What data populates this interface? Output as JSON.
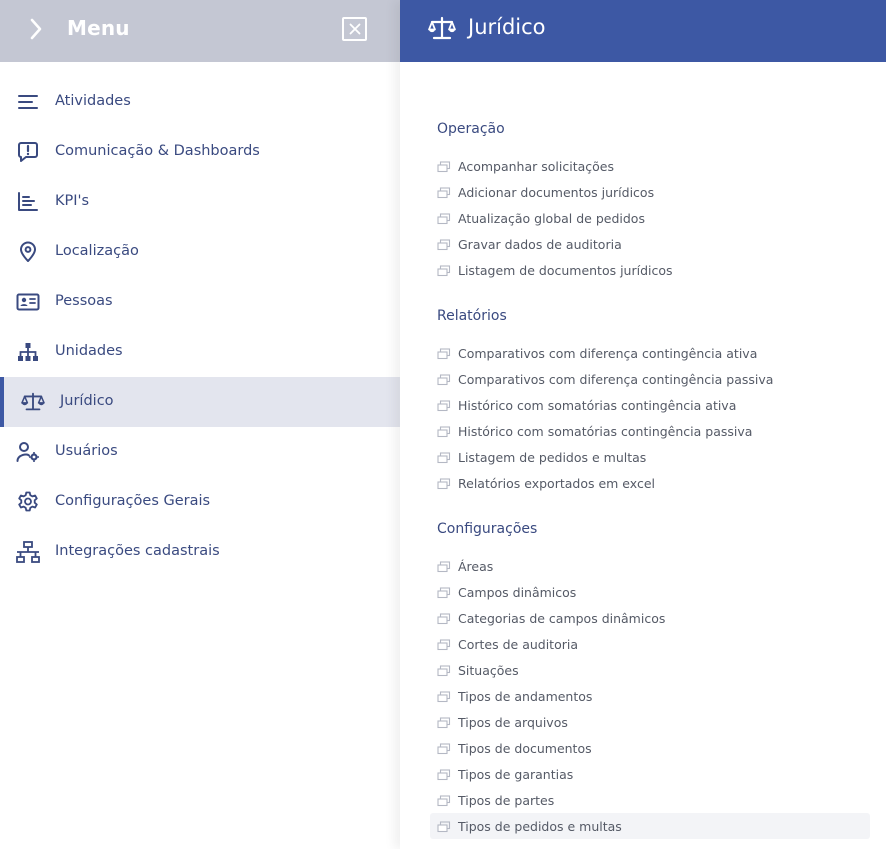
{
  "sidebar": {
    "title": "Menu",
    "chevron_icon": "chevron-right-icon",
    "close_icon": "close-box-icon",
    "items": [
      {
        "label": "Atividades",
        "icon": "list-icon"
      },
      {
        "label": "Comunicação & Dashboards",
        "icon": "message-alert-icon"
      },
      {
        "label": "KPI's",
        "icon": "chart-icon"
      },
      {
        "label": "Localização",
        "icon": "map-pin-icon"
      },
      {
        "label": "Pessoas",
        "icon": "id-card-icon"
      },
      {
        "label": "Unidades",
        "icon": "org-chart-icon"
      },
      {
        "label": "Jurídico",
        "icon": "scale-icon",
        "active": true
      },
      {
        "label": "Usuários",
        "icon": "user-gear-icon"
      },
      {
        "label": "Configurações Gerais",
        "icon": "gear-icon"
      },
      {
        "label": "Integrações cadastrais",
        "icon": "network-icon"
      }
    ]
  },
  "panel": {
    "title": "Jurídico",
    "icon": "scale-icon",
    "sections": [
      {
        "title": "Operação",
        "links": [
          "Acompanhar solicitações",
          "Adicionar documentos jurídicos",
          "Atualização global de pedidos",
          "Gravar dados de auditoria",
          "Listagem de documentos jurídicos"
        ]
      },
      {
        "title": "Relatórios",
        "links": [
          "Comparativos com diferença contingência ativa",
          "Comparativos com diferença contingência passiva",
          "Histórico com somatórias contingência ativa",
          "Histórico com somatórias contingência passiva",
          "Listagem de pedidos e multas",
          "Relatórios exportados em excel"
        ]
      },
      {
        "title": "Configurações",
        "links": [
          "Áreas",
          "Campos dinâmicos",
          "Categorias de campos dinâmicos",
          "Cortes de auditoria",
          "Situações",
          "Tipos de andamentos",
          "Tipos de arquivos",
          "Tipos de documentos",
          "Tipos de garantias",
          "Tipos de partes",
          "Tipos de pedidos e multas"
        ]
      }
    ]
  },
  "colors": {
    "brand": "#3d58a4",
    "sidebar_header": "#c4c7d3",
    "active_bg": "#e3e5ee",
    "text_primary": "#3a4a80",
    "text_link": "#555a66"
  }
}
